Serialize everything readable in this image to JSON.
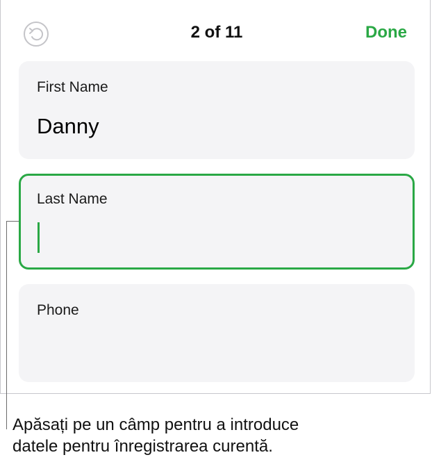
{
  "header": {
    "counter": "2 of 11",
    "done_label": "Done"
  },
  "fields": [
    {
      "label": "First Name",
      "value": "Danny"
    },
    {
      "label": "Last Name",
      "value": ""
    },
    {
      "label": "Phone",
      "value": ""
    }
  ],
  "caption": {
    "line1": "Apăsați pe un câmp pentru a introduce",
    "line2": "datele pentru înregistrarea curentă."
  },
  "colors": {
    "accent": "#2aa845",
    "field_bg": "#f4f4f6"
  }
}
